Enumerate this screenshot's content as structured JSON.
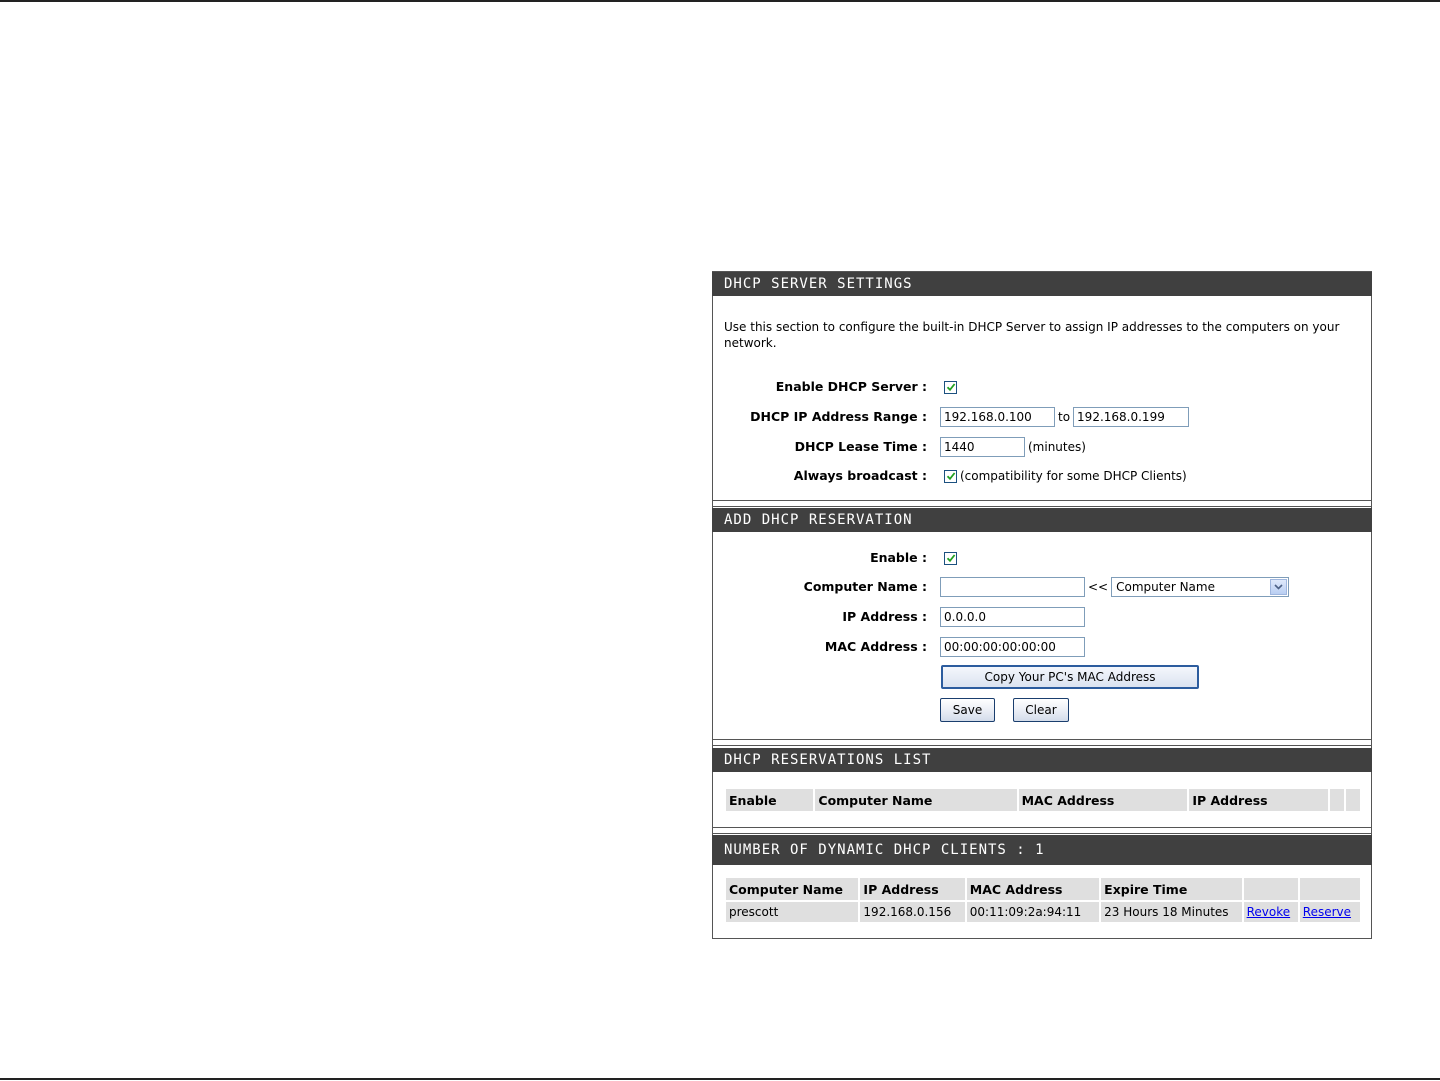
{
  "dhcp_server": {
    "header": "DHCP SERVER SETTINGS",
    "description": "Use this section to configure the built-in DHCP Server to assign IP addresses to the computers on your network.",
    "enable_label": "Enable DHCP Server :",
    "enable_checked": true,
    "range_label": "DHCP IP Address Range :",
    "range_start": "192.168.0.100",
    "range_to": "to",
    "range_end": "192.168.0.199",
    "lease_label": "DHCP Lease Time :",
    "lease_value": "1440",
    "lease_unit": "(minutes)",
    "broadcast_label": "Always broadcast :",
    "broadcast_checked": true,
    "broadcast_note": "(compatibility for some DHCP Clients)"
  },
  "reservation": {
    "header": "ADD DHCP RESERVATION",
    "enable_label": "Enable :",
    "enable_checked": true,
    "computer_name_label": "Computer Name :",
    "computer_name_value": "",
    "arrows": "<<",
    "computer_name_select": "Computer Name",
    "ip_label": "IP Address :",
    "ip_value": "0.0.0.0",
    "mac_label": "MAC Address :",
    "mac_value": "00:00:00:00:00:00",
    "copy_mac_button": "Copy Your PC's MAC Address",
    "save_button": "Save",
    "clear_button": "Clear"
  },
  "reservations_list": {
    "header": "DHCP RESERVATIONS LIST",
    "columns": [
      "Enable",
      "Computer Name",
      "MAC Address",
      "IP Address",
      "",
      ""
    ]
  },
  "clients": {
    "header": "NUMBER OF DYNAMIC DHCP CLIENTS : 1",
    "columns": [
      "Computer Name",
      "IP Address",
      "MAC Address",
      "Expire Time",
      "",
      ""
    ],
    "rows": [
      {
        "computer_name": "prescott",
        "ip": "192.168.0.156",
        "mac": "00:11:09:2a:94:11",
        "expire": "23 Hours 18 Minutes",
        "revoke": "Revoke",
        "reserve": "Reserve"
      }
    ]
  },
  "colors": {
    "header_bg": "#404040",
    "cell_bg": "#dfdfdf",
    "link": "#0000ee"
  }
}
